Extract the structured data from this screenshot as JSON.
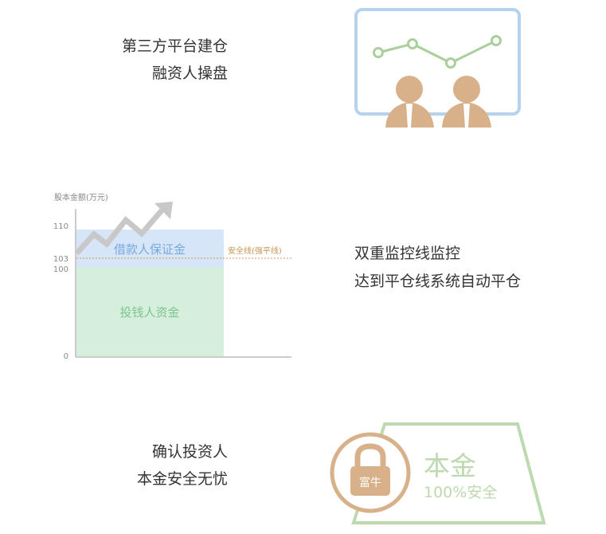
{
  "section1": {
    "line1": "第三方平台建仓",
    "line2": "融资人操盘"
  },
  "section2": {
    "line1": "双重监控线监控",
    "line2": "达到平仓线系统自动平仓",
    "chart": {
      "ylabel": "股本金额(万元)",
      "ticks": [
        "110",
        "103",
        "100",
        "0"
      ],
      "margin_label": "借款人保证金",
      "capital_label": "投钱人资金",
      "safety_line_label": "安全线(强平线)"
    }
  },
  "section3": {
    "line1": "确认投资人",
    "line2": "本金安全无忧",
    "lock_text": "富牛",
    "principal_title": "本金",
    "principal_sub": "100%安全"
  },
  "colors": {
    "green": "#a9cf9b",
    "tan": "#d8b08a",
    "blue": "#b5d3ee",
    "margin_fill": "#d6e6f8",
    "capital_fill": "#d6efdd",
    "safety_line": "#c9954f"
  }
}
